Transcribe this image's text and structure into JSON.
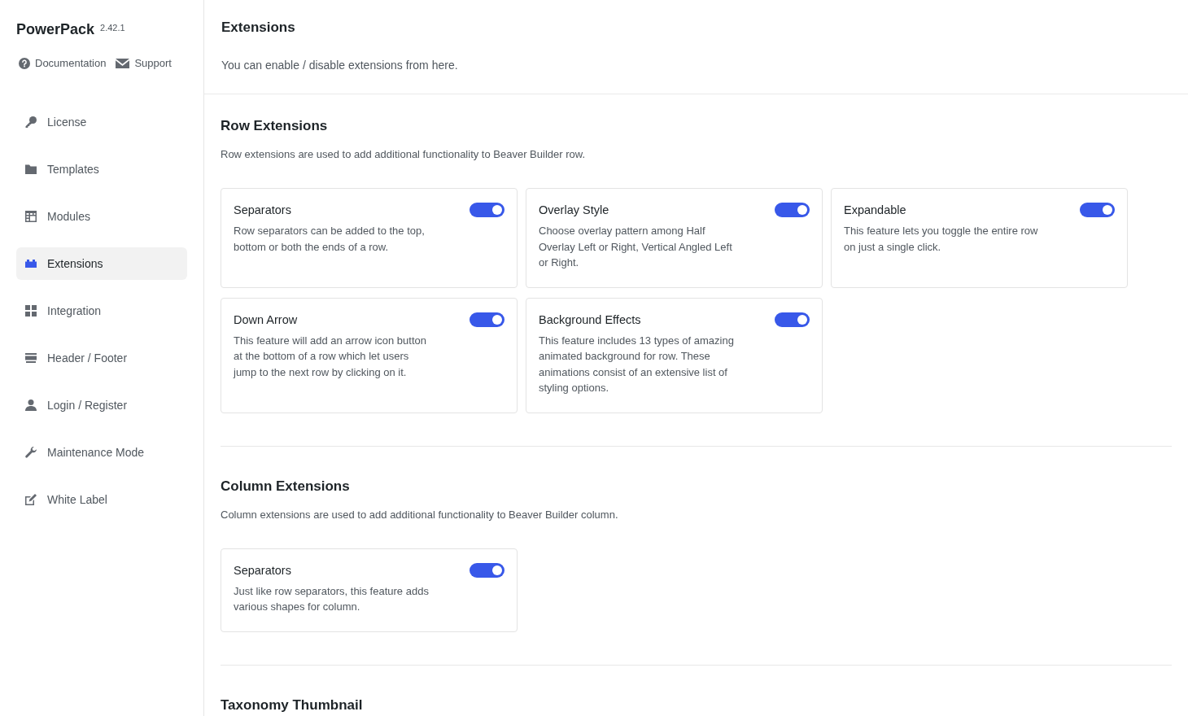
{
  "sidebar": {
    "brand": "PowerPack",
    "version": "2.42.1",
    "links": [
      {
        "label": "Documentation"
      },
      {
        "label": "Support"
      }
    ],
    "items": [
      {
        "label": "License",
        "selected": false
      },
      {
        "label": "Templates",
        "selected": false
      },
      {
        "label": "Modules",
        "selected": false
      },
      {
        "label": "Extensions",
        "selected": true
      },
      {
        "label": "Integration",
        "selected": false
      },
      {
        "label": "Header / Footer",
        "selected": false
      },
      {
        "label": "Login / Register",
        "selected": false
      },
      {
        "label": "Maintenance Mode",
        "selected": false
      },
      {
        "label": "White Label",
        "selected": false
      }
    ]
  },
  "header": {
    "title": "Extensions",
    "description": "You can enable / disable extensions from here."
  },
  "sections": [
    {
      "title": "Row Extensions",
      "description": "Row extensions are used to add additional functionality to Beaver Builder row.",
      "extensions": [
        {
          "name": "Separators",
          "description": "Row separators can be added to the top, bottom or both the ends of a row.",
          "on": true
        },
        {
          "name": "Overlay Style",
          "description": "Choose overlay pattern among Half Overlay Left or Right, Vertical Angled Left or Right.",
          "on": true
        },
        {
          "name": "Expandable",
          "description": "This feature lets you toggle the entire row on just a single click.",
          "on": true
        },
        {
          "name": "Down Arrow",
          "description": "This feature will add an arrow icon button at the bottom of a row which let users jump to the next row by clicking on it.",
          "on": true
        },
        {
          "name": "Background Effects",
          "description": "This feature includes 13 types of amazing animated background for row. These animations consist of an extensive list of styling options.",
          "on": true
        }
      ]
    },
    {
      "title": "Column Extensions",
      "description": "Column extensions are used to add additional functionality to Beaver Builder column.",
      "extensions": [
        {
          "name": "Separators",
          "description": "Just like row separators, this feature adds various shapes for column.",
          "on": true
        }
      ]
    },
    {
      "title": "Taxonomy Thumbnail"
    }
  ]
}
